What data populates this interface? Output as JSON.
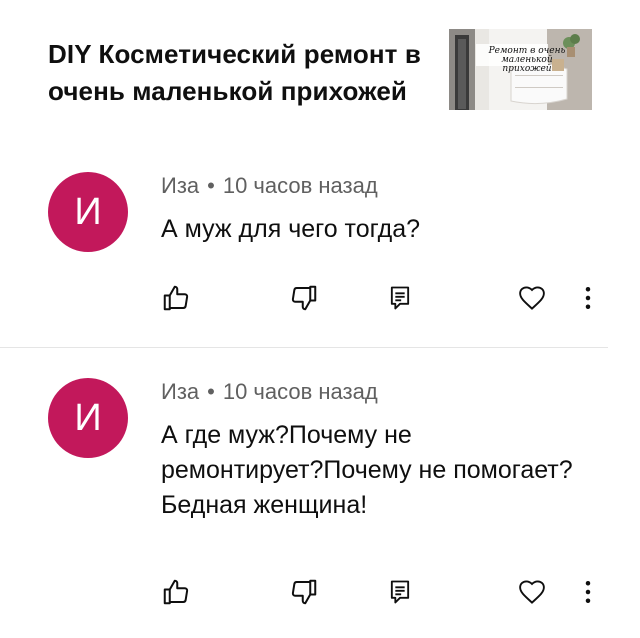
{
  "video": {
    "title": "DIY Косметический ремонт в очень маленькой прихожей",
    "thumbnail_caption": "Ремонт в очень маленькой прихожей"
  },
  "comments": [
    {
      "avatar_letter": "И",
      "author": "Иза",
      "separator": "•",
      "time": "10 часов назад",
      "text": "А муж для чего тогда?"
    },
    {
      "avatar_letter": "И",
      "author": "Иза",
      "separator": "•",
      "time": "10 часов назад",
      "text": "А где муж?Почему не ремонтирует?Почему не помогает?Бедная женщина!"
    }
  ],
  "icons": {
    "like": "thumbs-up-icon",
    "dislike": "thumbs-down-icon",
    "reply": "reply-comment-icon",
    "heart": "heart-icon",
    "more": "more-vertical-icon"
  },
  "colors": {
    "avatar_bg": "#c2185b",
    "meta_text": "#606060",
    "primary_text": "#0f0f0f"
  }
}
